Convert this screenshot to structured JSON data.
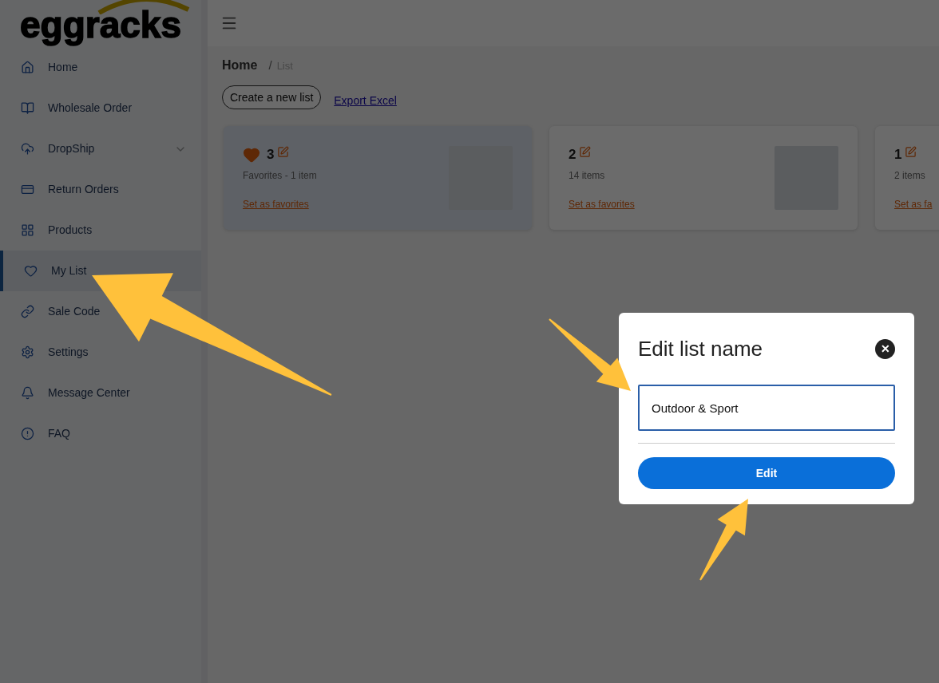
{
  "logo": "eggracks",
  "sidebar": {
    "items": [
      {
        "label": "Home",
        "selected": false,
        "expandable": false
      },
      {
        "label": "Wholesale Order",
        "selected": false,
        "expandable": false
      },
      {
        "label": "DropShip",
        "selected": false,
        "expandable": true
      },
      {
        "label": "Return Orders",
        "selected": false,
        "expandable": false
      },
      {
        "label": "Products",
        "selected": false,
        "expandable": false
      },
      {
        "label": "My List",
        "selected": true,
        "expandable": false
      },
      {
        "label": "Sale Code",
        "selected": false,
        "expandable": false
      },
      {
        "label": "Settings",
        "selected": false,
        "expandable": false
      },
      {
        "label": "Message Center",
        "selected": false,
        "expandable": false
      },
      {
        "label": "FAQ",
        "selected": false,
        "expandable": false
      }
    ]
  },
  "breadcrumb": [
    "Home",
    "/",
    "List"
  ],
  "actions": {
    "create": "Create a new list",
    "export": "Export Excel"
  },
  "lists": [
    {
      "name": "3",
      "subtitle": "Favorites - 1 item",
      "favorite": true,
      "selected": true,
      "link": "Set as favorites"
    },
    {
      "name": "2",
      "subtitle": "14 items",
      "favorite": false,
      "selected": false,
      "link": "Set as favorites"
    },
    {
      "name": "1",
      "subtitle": "2 items",
      "favorite": false,
      "selected": false,
      "link": "Set as fa"
    }
  ],
  "dialog": {
    "title": "Edit list name",
    "close": "✕",
    "value": "Outdoor & Sport",
    "button": "Edit"
  }
}
